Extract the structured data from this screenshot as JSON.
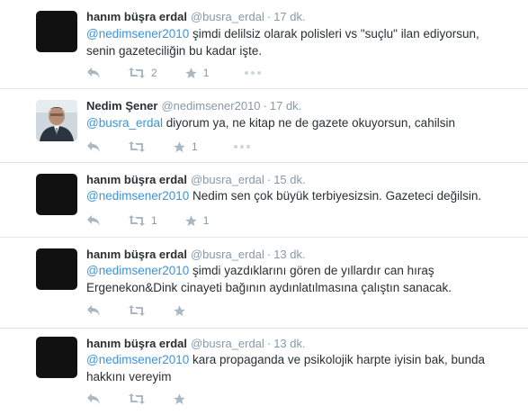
{
  "tweets": [
    {
      "fullname": "hanım büşra erdal",
      "username": "@busra_erdal",
      "time": "17 dk.",
      "mention": "@nedimsener2010",
      "text": " şimdi delilsiz olarak polisleri vs \"suçlu\" ilan ediyorsun, senin gazeteciliğin bu kadar işte.",
      "retweets": "2",
      "favorites": "1",
      "avatar": "black"
    },
    {
      "fullname": "Nedim Şener",
      "username": "@nedimsener2010",
      "time": "17 dk.",
      "mention": "@busra_erdal",
      "text": " diyorum ya, ne kitap ne de gazete okuyorsun, cahilsin",
      "retweets": "",
      "favorites": "1",
      "avatar": "photo"
    },
    {
      "fullname": "hanım büşra erdal",
      "username": "@busra_erdal",
      "time": "15 dk.",
      "mention": "@nedimsener2010",
      "text": " Nedim sen çok büyük terbiyesizsin. Gazeteci değilsin.",
      "retweets": "1",
      "favorites": "1",
      "avatar": "black"
    },
    {
      "fullname": "hanım büşra erdal",
      "username": "@busra_erdal",
      "time": "13 dk.",
      "mention": "@nedimsener2010",
      "text": " şimdi yazdıklarını gören de yıllardır can hıraş Ergenekon&Dink cinayeti bağının aydınlatılmasına çalıştın sanacak.",
      "retweets": "",
      "favorites": "",
      "avatar": "black"
    },
    {
      "fullname": "hanım büşra erdal",
      "username": "@busra_erdal",
      "time": "13 dk.",
      "mention": "@nedimsener2010",
      "text": " kara propaganda ve psikolojik harpte iyisin bak, bunda hakkını vereyim",
      "retweets": "",
      "favorites": "",
      "avatar": "black"
    }
  ],
  "separator": "·",
  "colors": {
    "mention": "#3b94d9",
    "meta": "#8899a6",
    "icon": "#aab8c2",
    "text": "#292f33"
  }
}
